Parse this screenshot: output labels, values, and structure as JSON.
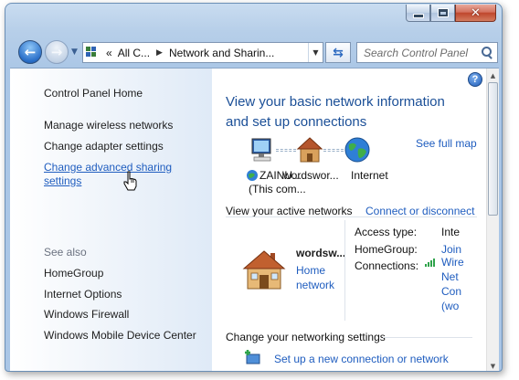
{
  "window": {
    "buttons": {
      "minimize": "minimize-icon",
      "maximize": "maximize-icon",
      "close": "close-icon"
    }
  },
  "nav": {
    "back_icon": "back-arrow-icon",
    "forward_icon": "forward-arrow-icon",
    "history_icon": "chevron-down-icon",
    "address": {
      "root": "«",
      "crumbs": [
        "All C...",
        "Network and Sharin..."
      ]
    },
    "refresh_icon": "refresh-icon",
    "search": {
      "placeholder": "Search Control Panel"
    }
  },
  "sidebar": {
    "home": "Control Panel Home",
    "tasks": [
      "Manage wireless networks",
      "Change adapter settings"
    ],
    "advanced": [
      "Change advanced sharing",
      "settings"
    ],
    "see_also_label": "See also",
    "see_also": [
      "HomeGroup",
      "Internet Options",
      "Windows Firewall",
      "Windows Mobile Device Center"
    ]
  },
  "main": {
    "title_lines": [
      "View your basic network information",
      "and set up connections"
    ],
    "see_full_map": "See full map",
    "map": {
      "computer_name": [
        "ZAINU...",
        "(This com..."
      ],
      "network_name": "wordswor...",
      "internet": "Internet"
    },
    "active_networks_heading": "View your active networks",
    "connect_disconnect": "Connect or disconnect",
    "network": {
      "name": "wordsw...",
      "type_lines": [
        "Home",
        "network"
      ]
    },
    "properties": {
      "access_type_label": "Access type:",
      "access_type_value": "Inte",
      "homegroup_label": "HomeGroup:",
      "homegroup_value": "Join",
      "connections_label": "Connections:",
      "connections_lines": [
        "Wire",
        "Net",
        "Con",
        "(wo"
      ]
    },
    "change_heading": "Change your networking settings",
    "setup_link": "Set up a new connection or network"
  },
  "colors": {
    "link": "#1f5dbf",
    "title": "#1b4f97",
    "signal": "#2fa34b"
  }
}
